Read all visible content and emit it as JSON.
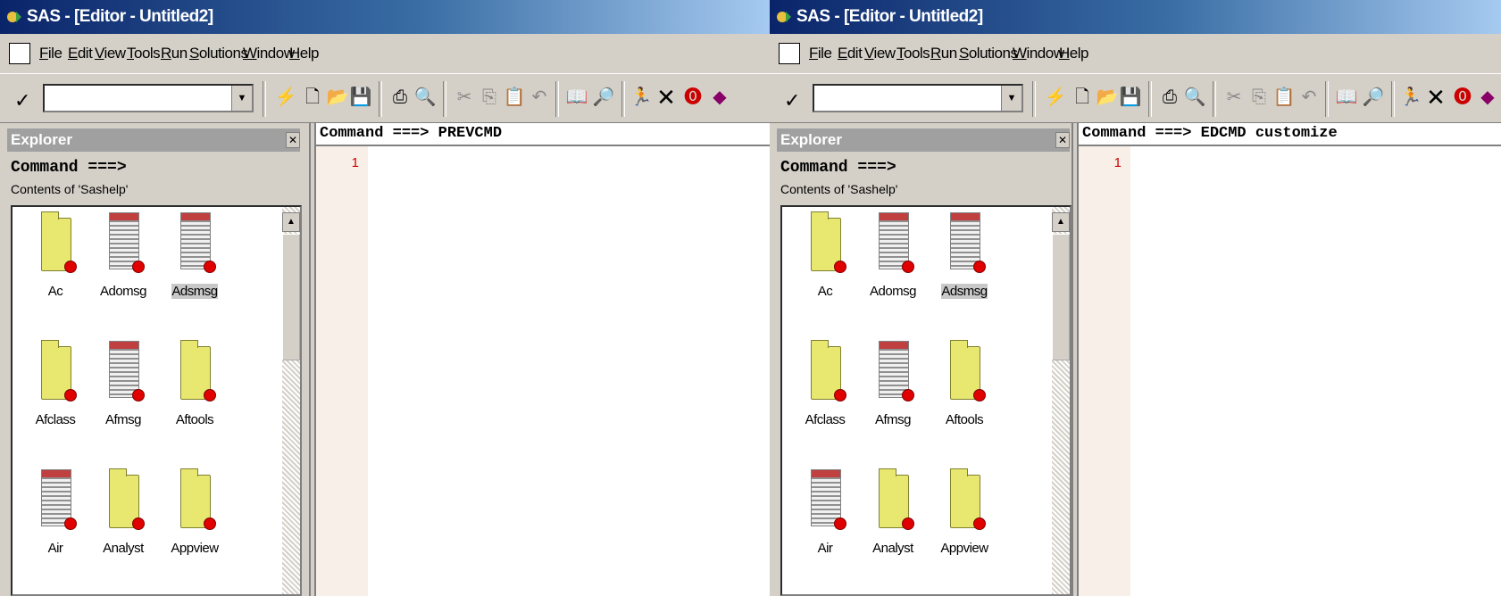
{
  "windows": [
    {
      "title": "SAS - [Editor - Untitled2]",
      "menu": [
        "File",
        "Edit",
        "View",
        "Tools",
        "Run",
        "Solutions",
        "Window",
        "Help"
      ],
      "command_box_value": "",
      "explorer": {
        "title": "Explorer",
        "command_label": "Command ===>",
        "contents_label": "Contents of 'Sashelp'",
        "items": [
          {
            "label": "Ac",
            "type": "folder"
          },
          {
            "label": "Adomsg",
            "type": "dataset"
          },
          {
            "label": "Adsmsg",
            "type": "dataset",
            "selected": true
          },
          {
            "label": "Afclass",
            "type": "folder"
          },
          {
            "label": "Afmsg",
            "type": "dataset"
          },
          {
            "label": "Aftools",
            "type": "folder"
          },
          {
            "label": "Air",
            "type": "dataset"
          },
          {
            "label": "Analyst",
            "type": "folder"
          },
          {
            "label": "Appview",
            "type": "folder"
          }
        ]
      },
      "editor": {
        "command_line": "Command ===> PREVCMD",
        "line_number": "1"
      }
    },
    {
      "title": "SAS - [Editor - Untitled2]",
      "menu": [
        "File",
        "Edit",
        "View",
        "Tools",
        "Run",
        "Solutions",
        "Window",
        "Help"
      ],
      "command_box_value": "",
      "explorer": {
        "title": "Explorer",
        "command_label": "Command ===>",
        "contents_label": "Contents of 'Sashelp'",
        "items": [
          {
            "label": "Ac",
            "type": "folder"
          },
          {
            "label": "Adomsg",
            "type": "dataset"
          },
          {
            "label": "Adsmsg",
            "type": "dataset",
            "selected": true
          },
          {
            "label": "Afclass",
            "type": "folder"
          },
          {
            "label": "Afmsg",
            "type": "dataset"
          },
          {
            "label": "Aftools",
            "type": "folder"
          },
          {
            "label": "Air",
            "type": "dataset"
          },
          {
            "label": "Analyst",
            "type": "folder"
          },
          {
            "label": "Appview",
            "type": "folder"
          }
        ]
      },
      "editor": {
        "command_line": "Command ===> EDCMD customize",
        "line_number": "1"
      }
    }
  ],
  "toolbar_icons": [
    "checkmark-icon",
    "new-file-icon",
    "open-folder-icon",
    "save-icon",
    "print-icon",
    "print-preview-icon",
    "cut-icon",
    "copy-icon",
    "paste-icon",
    "undo-icon",
    "new-library-icon",
    "explorer-icon",
    "submit-icon",
    "clear-icon",
    "help-icon",
    "doc-icon"
  ],
  "colors": {
    "title_bar": "#0a246a",
    "line_number": "#d00000",
    "folder": "#e8e870",
    "badge": "#e00000"
  }
}
